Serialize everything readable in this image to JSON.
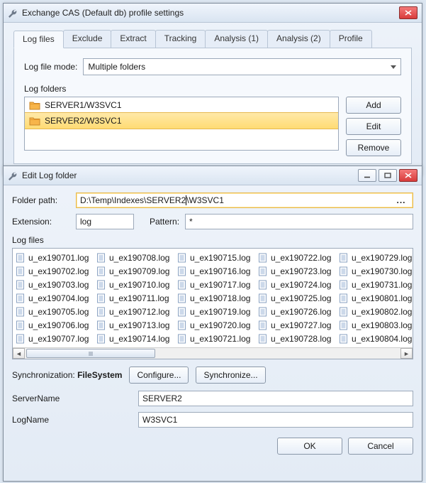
{
  "win1": {
    "title": "Exchange CAS (Default db) profile settings",
    "tabs": [
      "Log files",
      "Exclude",
      "Extract",
      "Tracking",
      "Analysis (1)",
      "Analysis (2)",
      "Profile"
    ],
    "active_tab_index": 0,
    "log_file_mode": {
      "label": "Log file mode:",
      "value": "Multiple folders"
    },
    "log_folders": {
      "label": "Log folders",
      "items": [
        "SERVER1/W3SVC1",
        "SERVER2/W3SVC1"
      ],
      "selected_index": 1,
      "buttons": {
        "add": "Add",
        "edit": "Edit",
        "remove": "Remove"
      }
    }
  },
  "win2": {
    "title": "Edit Log folder",
    "folder_path": {
      "label": "Folder path:",
      "value_before_caret": "D:\\Temp\\Indexes\\SERVER2",
      "value_after_caret": "\\W3SVC1",
      "ellipsis": "..."
    },
    "extension": {
      "label": "Extension:",
      "value": "log"
    },
    "pattern": {
      "label": "Pattern:",
      "value": "*"
    },
    "logfiles_label": "Log files",
    "logfiles": [
      [
        "u_ex190701.log",
        "u_ex190702.log",
        "u_ex190703.log",
        "u_ex190704.log",
        "u_ex190705.log",
        "u_ex190706.log",
        "u_ex190707.log"
      ],
      [
        "u_ex190708.log",
        "u_ex190709.log",
        "u_ex190710.log",
        "u_ex190711.log",
        "u_ex190712.log",
        "u_ex190713.log",
        "u_ex190714.log"
      ],
      [
        "u_ex190715.log",
        "u_ex190716.log",
        "u_ex190717.log",
        "u_ex190718.log",
        "u_ex190719.log",
        "u_ex190720.log",
        "u_ex190721.log"
      ],
      [
        "u_ex190722.log",
        "u_ex190723.log",
        "u_ex190724.log",
        "u_ex190725.log",
        "u_ex190726.log",
        "u_ex190727.log",
        "u_ex190728.log"
      ],
      [
        "u_ex190729.log",
        "u_ex190730.log",
        "u_ex190731.log",
        "u_ex190801.log",
        "u_ex190802.log",
        "u_ex190803.log",
        "u_ex190804.log"
      ]
    ],
    "sync": {
      "label": "Synchronization:",
      "value": "FileSystem",
      "configure": "Configure...",
      "synchronize": "Synchronize..."
    },
    "server_name": {
      "label": "ServerName",
      "value": "SERVER2"
    },
    "log_name": {
      "label": "LogName",
      "value": "W3SVC1"
    },
    "footer": {
      "ok": "OK",
      "cancel": "Cancel"
    }
  }
}
